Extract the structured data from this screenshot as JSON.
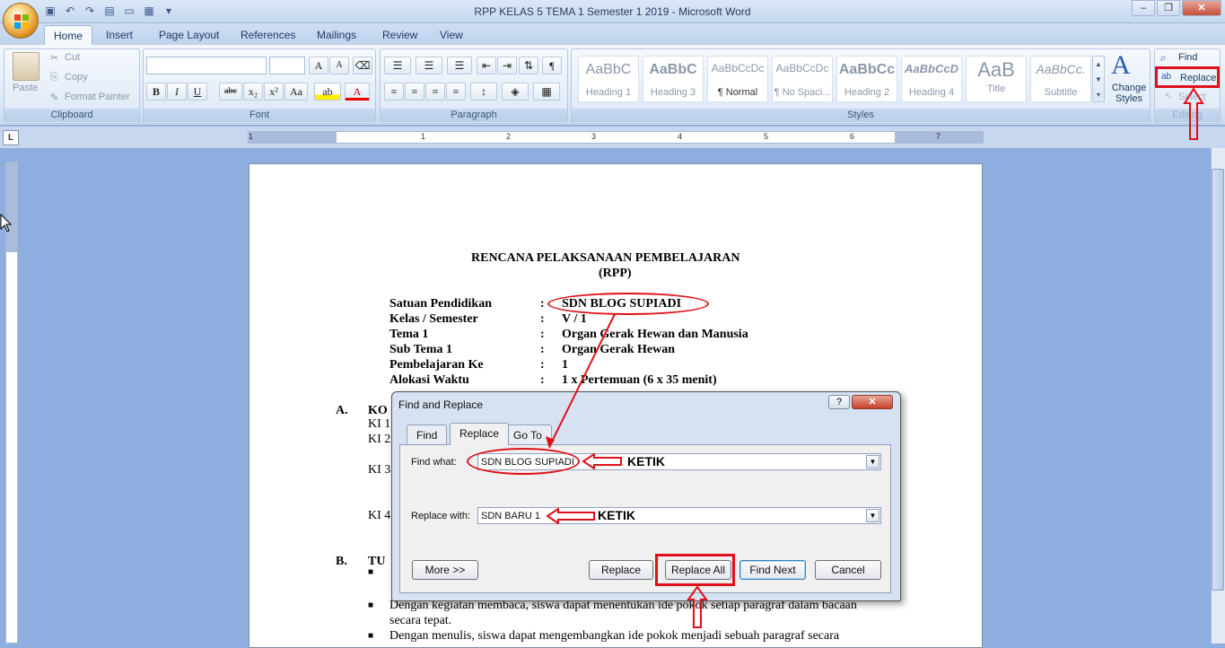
{
  "window": {
    "title": "RPP KELAS 5 TEMA 1 Semester 1 2019 - Microsoft Word"
  },
  "tabs": [
    "Home",
    "Insert",
    "Page Layout",
    "References",
    "Mailings",
    "Review",
    "View"
  ],
  "clipboard": {
    "paste": "Paste",
    "cut": "Cut",
    "copy": "Copy",
    "format_painter": "Format Painter",
    "label": "Clipboard"
  },
  "font": {
    "label": "Font",
    "bold": "B",
    "italic": "I",
    "underline": "U",
    "strike": "abc",
    "sub": "x₂",
    "sup": "x²",
    "case": "Aa",
    "grow": "A",
    "shrink": "A"
  },
  "paragraph": {
    "label": "Paragraph"
  },
  "styles": {
    "label": "Styles",
    "items": [
      {
        "sample": "AaBbC",
        "name": "Heading 1"
      },
      {
        "sample": "AaBbC",
        "name": "Heading 3"
      },
      {
        "sample": "AaBbCcDc",
        "name": "¶ Normal"
      },
      {
        "sample": "AaBbCcDc",
        "name": "¶ No Spaci..."
      },
      {
        "sample": "AaBbCc",
        "name": "Heading 2"
      },
      {
        "sample": "AaBbCcD",
        "name": "Heading 4"
      },
      {
        "sample": "AaB",
        "name": "Title"
      },
      {
        "sample": "AaBbCc.",
        "name": "Subtitle"
      }
    ],
    "change_styles": "Change Styles"
  },
  "editing": {
    "find": "Find",
    "replace": "Replace",
    "select": "Select",
    "label": "Editing"
  },
  "ruler_numbers": [
    "1",
    "1",
    "2",
    "3",
    "4",
    "5",
    "6",
    "7"
  ],
  "document": {
    "title1": "RENCANA PELAKSANAAN PEMBELAJARAN",
    "title2": "(RPP)",
    "fields": [
      {
        "label": "Satuan Pendidikan",
        "value": "SDN BLOG SUPIADI"
      },
      {
        "label": "Kelas / Semester",
        "value": "V / 1"
      },
      {
        "label": "Tema 1",
        "value": "Organ Gerak Hewan dan Manusia"
      },
      {
        "label": "Sub Tema 1",
        "value": "Organ Gerak Hewan"
      },
      {
        "label": "Pembelajaran Ke",
        "value": "1"
      },
      {
        "label": "Alokasi Waktu",
        "value": "1 x Pertemuan (6 x 35 menit)"
      }
    ],
    "colon": ":",
    "section_a_letter": "A.",
    "section_a_title": "KO",
    "ki1": "KI 1",
    "ki2": "KI 2",
    "ki3": "KI 3",
    "ki4": "KI 4",
    "section_b_letter": "B.",
    "section_b_title": "TU",
    "bullet2_line1": "Dengan kegiatan membaca, siswa dapat menentukan ide pokok setiap paragraf dalam bacaan",
    "bullet2_line2": "secara tepat.",
    "bullet3_line1": "Dengan menulis, siswa dapat mengembangkan ide pokok menjadi sebuah paragraf secara"
  },
  "dialog": {
    "title": "Find and Replace",
    "help": "?",
    "close": "✕",
    "tabs": [
      "Find",
      "Replace",
      "Go To"
    ],
    "find_label": "Find what:",
    "find_value": "SDN BLOG SUPIADI",
    "replace_label": "Replace with:",
    "replace_value": "SDN BARU 1",
    "more": "More >>",
    "replace": "Replace",
    "replace_all": "Replace All",
    "find_next": "Find Next",
    "cancel": "Cancel"
  },
  "annotations": {
    "ketik1": "KETIK",
    "ketik2": "KETIK"
  },
  "colors": {
    "annotation_red": "#e0101a",
    "ribbon_blue": "#dde8f6",
    "doc_bg": "#8eaee0"
  }
}
